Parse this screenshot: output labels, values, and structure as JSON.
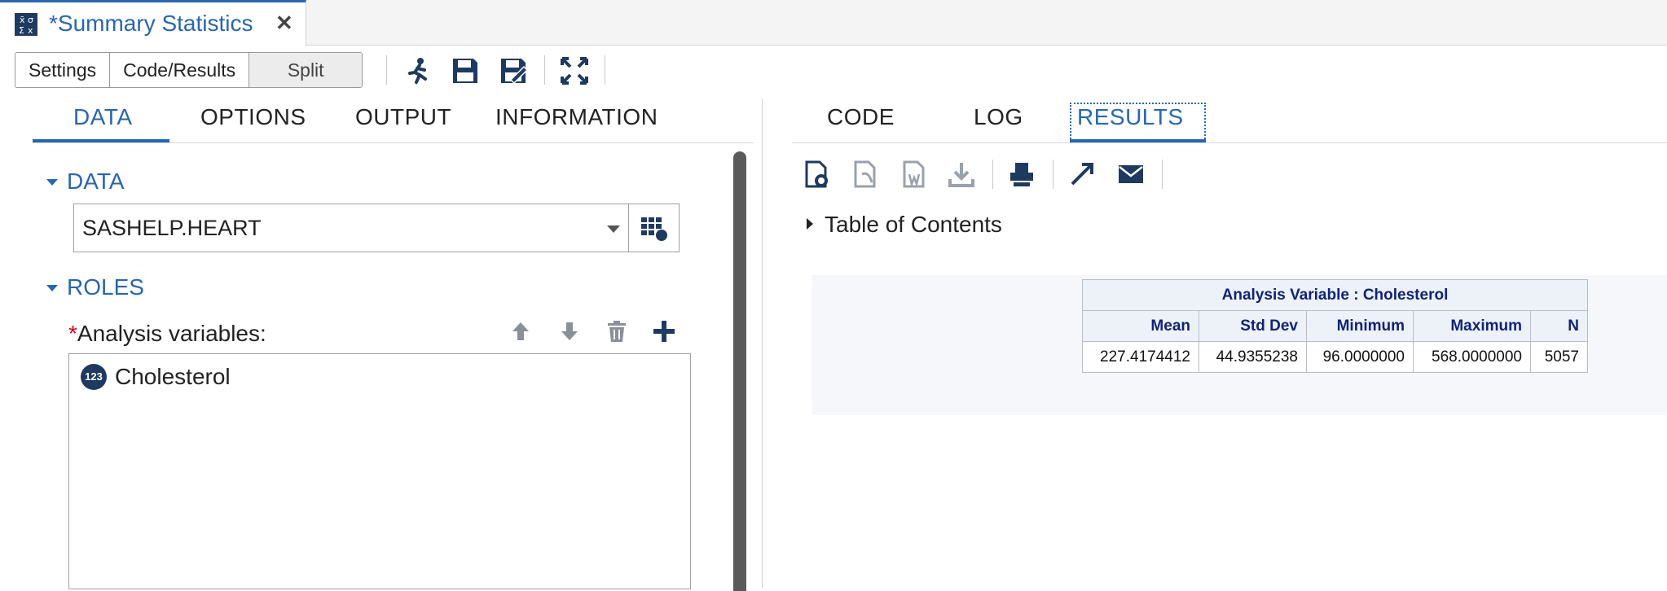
{
  "tab": {
    "title": "*Summary Statistics",
    "close_glyph": "✕"
  },
  "toolbar": {
    "view_buttons": [
      "Settings",
      "Code/Results",
      "Split"
    ],
    "selected_view": "Split",
    "icons": [
      "run-icon",
      "save-icon",
      "save-as-icon",
      "maximize-icon"
    ]
  },
  "left": {
    "tabs": [
      "DATA",
      "OPTIONS",
      "OUTPUT",
      "INFORMATION"
    ],
    "active_tab": "DATA",
    "data_section": {
      "heading": "DATA",
      "dataset": "SASHELP.HEART"
    },
    "roles_section": {
      "heading": "ROLES",
      "required_mark": "*",
      "analysis_label": "Analysis variables:",
      "variable_type_badge": "123",
      "variables": [
        "Cholesterol"
      ]
    }
  },
  "right": {
    "tabs": [
      "CODE",
      "LOG",
      "RESULTS"
    ],
    "active_tab": "RESULTS",
    "icons": [
      "html-icon",
      "pdf-icon",
      "word-icon",
      "download-icon",
      "print-icon",
      "expand-icon",
      "email-icon"
    ],
    "toc_label": "Table of Contents",
    "table": {
      "caption": "Analysis Variable : Cholesterol",
      "headers": [
        "Mean",
        "Std Dev",
        "Minimum",
        "Maximum",
        "N"
      ],
      "row": [
        "227.4174412",
        "44.9355238",
        "96.0000000",
        "568.0000000",
        "5057"
      ]
    }
  },
  "colors": {
    "accent": "#2866b0",
    "table_header_text": "#112277",
    "required": "#d0021b"
  }
}
